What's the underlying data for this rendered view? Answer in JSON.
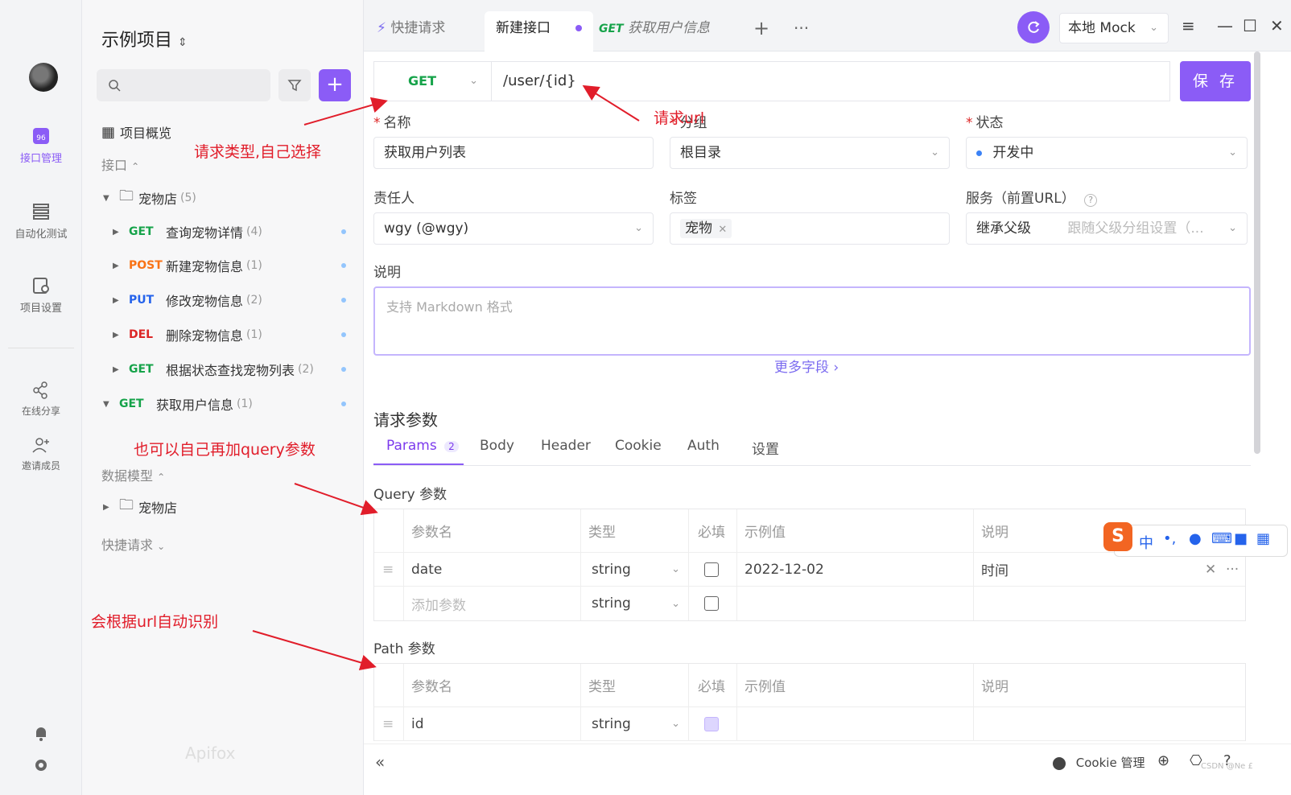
{
  "project": {
    "title": "示例项目 ⌃⌄",
    "title_text": "示例项目"
  },
  "rail": {
    "items": [
      {
        "label": "接口管理",
        "icon": "api-icon"
      },
      {
        "label": "自动化测试",
        "icon": "automation-icon"
      },
      {
        "label": "项目设置",
        "icon": "settings-icon"
      },
      {
        "label": "在线分享",
        "icon": "share-icon"
      },
      {
        "label": "邀请成员",
        "icon": "invite-icon"
      }
    ]
  },
  "sidebar": {
    "overview": "项目概览",
    "section_api": "接口",
    "folder": {
      "name": "宠物店",
      "count": "(5)"
    },
    "apis": [
      {
        "method": "GET",
        "name": "查询宠物详情",
        "count": "(4)"
      },
      {
        "method": "POST",
        "name": "新建宠物信息",
        "count": "(1)"
      },
      {
        "method": "PUT",
        "name": "修改宠物信息",
        "count": "(2)"
      },
      {
        "method": "DEL",
        "name": "删除宠物信息",
        "count": "(1)"
      },
      {
        "method": "GET",
        "name": "根据状态查找宠物列表",
        "count": "(2)"
      }
    ],
    "root_api": {
      "method": "GET",
      "name": "获取用户信息",
      "count": "(1)"
    },
    "section_models": "数据模型",
    "model_folder": "宠物店",
    "section_quick": "快捷请求",
    "brand": "Apifox"
  },
  "tabs": {
    "quick": "快捷请求",
    "new_api": "新建接口",
    "get_label": "GET",
    "get_user": "获取用户信息",
    "env": "本地 Mock"
  },
  "request": {
    "method": "GET",
    "url": "/user/{id}",
    "save": "保 存"
  },
  "form": {
    "name_label": "名称",
    "name_value": "获取用户列表",
    "group_label": "分组",
    "group_value": "根目录",
    "status_label": "状态",
    "status_value": "开发中",
    "owner_label": "责任人",
    "owner_value": "wgy (@wgy)",
    "tag_label": "标签",
    "tag_value": "宠物",
    "service_label": "服务（前置URL）",
    "service_value": "继承父级",
    "service_hint": "跟随父级分组设置（...",
    "desc_label": "说明",
    "desc_placeholder": "支持 Markdown 格式",
    "more_fields": "更多字段 ›"
  },
  "params": {
    "title": "请求参数",
    "tabs": [
      "Params",
      "Body",
      "Header",
      "Cookie",
      "Auth",
      "设置"
    ],
    "params_count": "2",
    "query_title": "Query 参数",
    "path_title": "Path 参数",
    "headers": [
      "参数名",
      "类型",
      "必填",
      "示例值",
      "说明"
    ],
    "query_rows": [
      {
        "name": "date",
        "type": "string",
        "required": false,
        "example": "2022-12-02",
        "desc": "时间"
      }
    ],
    "add_param": "添加参数",
    "add_type": "string",
    "path_rows": [
      {
        "name": "id",
        "type": "string",
        "required": true
      }
    ]
  },
  "statusbar": {
    "cookie": "Cookie 管理",
    "watermark": "CSDN @Ne £"
  },
  "ime": {
    "label": "中"
  },
  "annotations": {
    "method": "请求类型,自己选择",
    "url": "请求url",
    "query": "也可以自己再加query参数",
    "auto": "会根据url自动识别"
  },
  "colors": {
    "accent": "#8b5cf6",
    "get": "#16a34a",
    "post": "#f97316",
    "put": "#2563eb",
    "del": "#dc2626",
    "annotation": "#e11d2a"
  }
}
